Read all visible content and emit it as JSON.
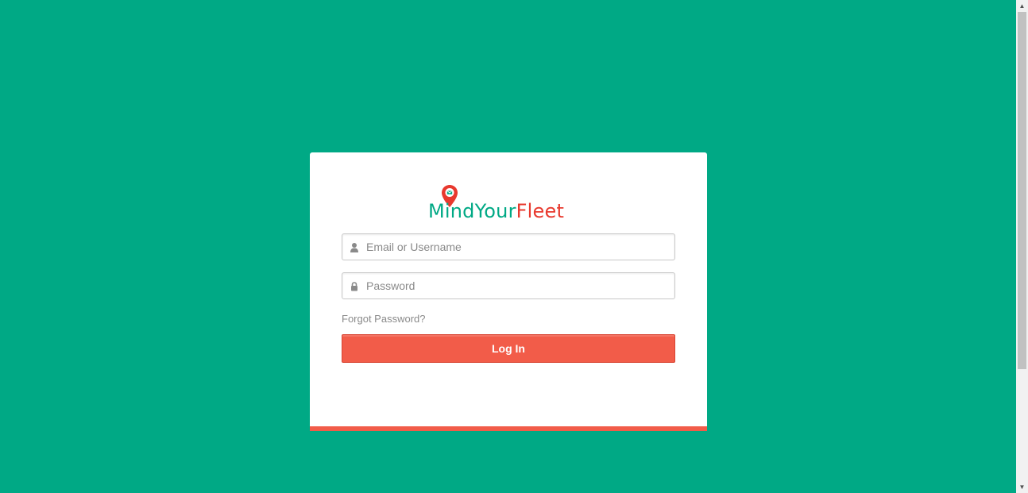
{
  "brand": {
    "name_part1": "MindYour",
    "name_part2": "Fleet",
    "green": "#00a985",
    "red": "#e8392e"
  },
  "colors": {
    "background": "#00a985",
    "accent": "#f25c49"
  },
  "form": {
    "email": {
      "placeholder": "Email or Username",
      "icon": "user-icon"
    },
    "password": {
      "placeholder": "Password",
      "icon": "lock-icon"
    },
    "forgot_label": "Forgot Password?",
    "login_label": "Log In"
  },
  "scrollbar": {
    "up_glyph": "▲",
    "down_glyph": "▼"
  }
}
